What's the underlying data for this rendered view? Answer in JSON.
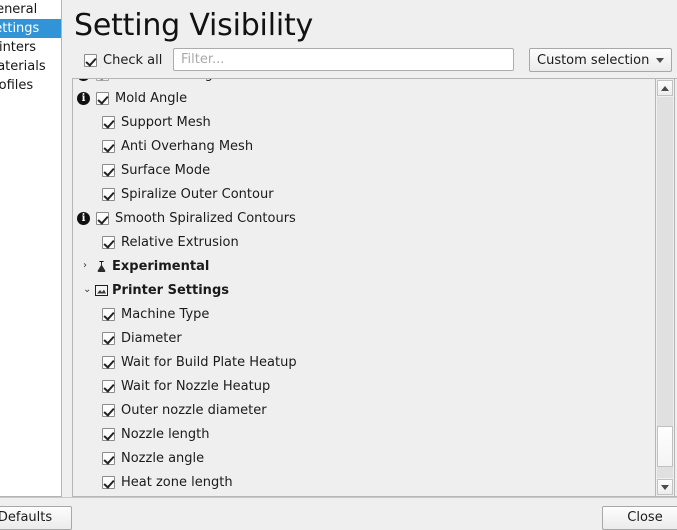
{
  "sidebar": {
    "items": [
      {
        "label": "General",
        "selected": false
      },
      {
        "label": "Settings",
        "selected": true
      },
      {
        "label": "Printers",
        "selected": false
      },
      {
        "label": "Materials",
        "selected": false
      },
      {
        "label": "Profiles",
        "selected": false
      }
    ]
  },
  "header": {
    "title": "Setting Visibility"
  },
  "toolbar": {
    "check_all_label": "Check all",
    "check_all_checked": true,
    "filter_value": "",
    "filter_placeholder": "Filter...",
    "selection_preset": "Custom selection",
    "combo_arrow_icon": "chevron-down-icon"
  },
  "list": {
    "rows": [
      {
        "label": "Mold Roof Height",
        "type": "setting",
        "checked": true,
        "info": true,
        "clipped": true
      },
      {
        "label": "Mold Angle",
        "type": "setting",
        "checked": true,
        "info": true
      },
      {
        "label": "Support Mesh",
        "type": "setting",
        "checked": true,
        "info": false
      },
      {
        "label": "Anti Overhang Mesh",
        "type": "setting",
        "checked": true,
        "info": false
      },
      {
        "label": "Surface Mode",
        "type": "setting",
        "checked": true,
        "info": false
      },
      {
        "label": "Spiralize Outer Contour",
        "type": "setting",
        "checked": true,
        "info": false
      },
      {
        "label": "Smooth Spiralized Contours",
        "type": "setting",
        "checked": true,
        "info": true
      },
      {
        "label": "Relative Extrusion",
        "type": "setting",
        "checked": true,
        "info": false
      },
      {
        "label": "Experimental",
        "type": "category",
        "expanded": false,
        "icon": "flask-icon"
      },
      {
        "label": "Printer Settings",
        "type": "category",
        "expanded": true,
        "icon": "printer-icon"
      },
      {
        "label": "Machine Type",
        "type": "setting",
        "checked": true,
        "info": false
      },
      {
        "label": "Diameter",
        "type": "setting",
        "checked": true,
        "info": false
      },
      {
        "label": "Wait for Build Plate Heatup",
        "type": "setting",
        "checked": true,
        "info": false
      },
      {
        "label": "Wait for Nozzle Heatup",
        "type": "setting",
        "checked": true,
        "info": false
      },
      {
        "label": "Outer nozzle diameter",
        "type": "setting",
        "checked": true,
        "info": false
      },
      {
        "label": "Nozzle length",
        "type": "setting",
        "checked": true,
        "info": false
      },
      {
        "label": "Nozzle angle",
        "type": "setting",
        "checked": true,
        "info": false
      },
      {
        "label": "Heat zone length",
        "type": "setting",
        "checked": true,
        "info": false
      }
    ]
  },
  "scrollbar": {
    "up_icon": "scroll-up-arrow-icon",
    "down_icon": "scroll-down-arrow-icon"
  },
  "footer": {
    "defaults_label": "Defaults",
    "close_label": "Close"
  },
  "colors": {
    "selection_blue": "#3194d6",
    "window_bg": "#efefef",
    "field_bg": "#ffffff",
    "border": "#b6b6b6",
    "text": "#1b1b1b"
  }
}
